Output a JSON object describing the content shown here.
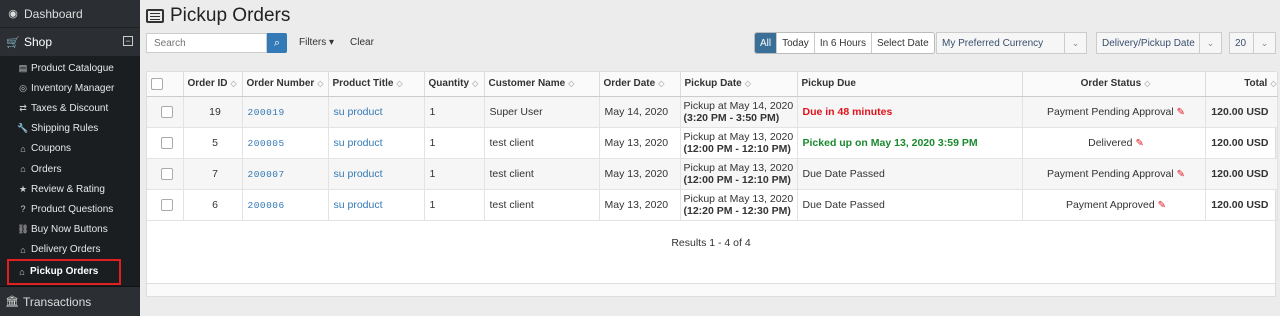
{
  "sidebar": {
    "dashboard": "Dashboard",
    "shop": "Shop",
    "shop_toggle": "−",
    "items": [
      {
        "label": "Product Catalogue",
        "icon": "book-icon"
      },
      {
        "label": "Inventory Manager",
        "icon": "inventory-icon"
      },
      {
        "label": "Taxes & Discount",
        "icon": "exchange-icon"
      },
      {
        "label": "Shipping Rules",
        "icon": "wrench-icon"
      },
      {
        "label": "Coupons",
        "icon": "tag-icon"
      },
      {
        "label": "Orders",
        "icon": "tag-icon"
      },
      {
        "label": "Review & Rating",
        "icon": "star-icon"
      },
      {
        "label": "Product Questions",
        "icon": "question-icon"
      },
      {
        "label": "Buy Now Buttons",
        "icon": "link-icon"
      },
      {
        "label": "Delivery Orders",
        "icon": "tag-icon"
      },
      {
        "label": "Pickup Orders",
        "icon": "tag-icon",
        "active": true
      }
    ],
    "transactions": "Transactions"
  },
  "header": {
    "title": "Pickup Orders"
  },
  "toolbar": {
    "search_placeholder": "Search",
    "filters_label": "Filters ▾",
    "clear_label": "Clear",
    "ranges": [
      "All",
      "Today",
      "In 6 Hours",
      "Select Date"
    ],
    "active_range": "All",
    "currency_select": "My Preferred Currency",
    "date_type_select": "Delivery/Pickup Date",
    "page_size_select": "20"
  },
  "table": {
    "columns": [
      "",
      "Order ID",
      "Order Number",
      "Product Title",
      "Quantity",
      "Customer Name",
      "Order Date",
      "Pickup Date",
      "Pickup Due",
      "Order Status",
      "Total"
    ],
    "rows": [
      {
        "order_id": "19",
        "order_number": "200019",
        "product": "su product",
        "quantity": "1",
        "customer": "Super User",
        "order_date": "May 14, 2020",
        "pickup_line1": "Pickup at May 14, 2020",
        "pickup_line2": "(3:20 PM - 3:50 PM)",
        "due": "Due in 48 minutes",
        "due_style": "red",
        "status": "Payment Pending Approval",
        "total": "120.00 USD"
      },
      {
        "order_id": "5",
        "order_number": "200005",
        "product": "su product",
        "quantity": "1",
        "customer": "test client",
        "order_date": "May 13, 2020",
        "pickup_line1": "Pickup at May 13, 2020",
        "pickup_line2": "(12:00 PM - 12:10 PM)",
        "due": "Picked up on May 13, 2020 3:59 PM",
        "due_style": "green",
        "status": "Delivered",
        "total": "120.00 USD"
      },
      {
        "order_id": "7",
        "order_number": "200007",
        "product": "su product",
        "quantity": "1",
        "customer": "test client",
        "order_date": "May 13, 2020",
        "pickup_line1": "Pickup at May 13, 2020",
        "pickup_line2": "(12:00 PM - 12:10 PM)",
        "due": "Due Date Passed",
        "due_style": "plain",
        "status": "Payment Pending Approval",
        "total": "120.00 USD"
      },
      {
        "order_id": "6",
        "order_number": "200006",
        "product": "su product",
        "quantity": "1",
        "customer": "test client",
        "order_date": "May 13, 2020",
        "pickup_line1": "Pickup at May 13, 2020",
        "pickup_line2": "(12:20 PM - 12:30 PM)",
        "due": "Due Date Passed",
        "due_style": "plain",
        "status": "Payment Approved",
        "total": "120.00 USD"
      }
    ],
    "results_text": "Results 1 - 4 of 4"
  },
  "colors": {
    "sidebar_bg": "#2b2f33",
    "accent_blue": "#337ab7",
    "active_range_bg": "#3a6f97",
    "due_red": "#e0121b",
    "delivered_green": "#1a8a2e",
    "highlight_box": "#e02020"
  }
}
